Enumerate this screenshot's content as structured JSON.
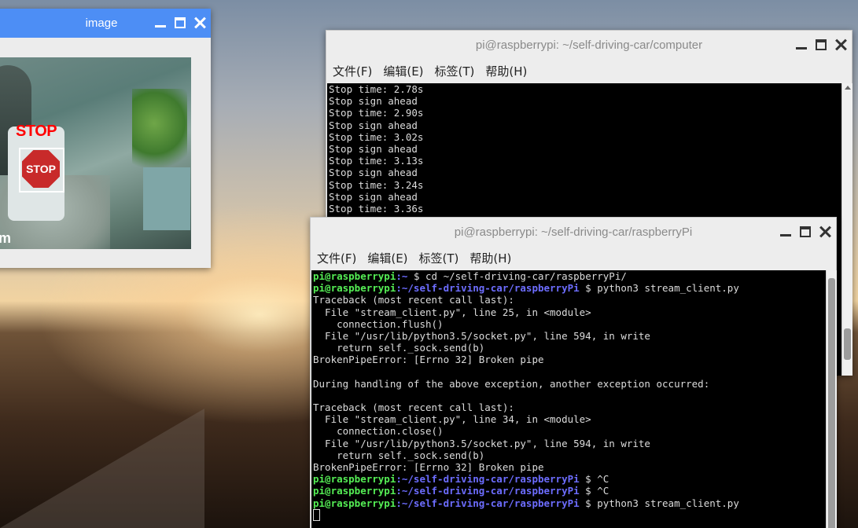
{
  "image_window": {
    "title": "image",
    "detection_label": "STOP",
    "sign_text": "STOP",
    "distance_text": "m"
  },
  "computer_window": {
    "title": "pi@raspberrypi: ~/self-driving-car/computer",
    "menu": [
      "文件(F)",
      "编辑(E)",
      "标签(T)",
      "帮助(H)"
    ],
    "lines": [
      "Stop time: 2.78s",
      "Stop sign ahead",
      "Stop time: 2.90s",
      "Stop sign ahead",
      "Stop time: 3.02s",
      "Stop sign ahead",
      "Stop time: 3.13s",
      "Stop sign ahead",
      "Stop time: 3.24s",
      "Stop sign ahead",
      "Stop time: 3.36s"
    ]
  },
  "raspberrypi_window": {
    "title": "pi@raspberrypi: ~/self-driving-car/raspberryPi",
    "menu": [
      "文件(F)",
      "编辑(E)",
      "标签(T)",
      "帮助(H)"
    ],
    "lines": [
      {
        "user": "pi@raspberrypi",
        "path": ":~",
        "cmd": " $ cd ~/self-driving-car/raspberryPi/"
      },
      {
        "user": "pi@raspberrypi",
        "path": ":~/self-driving-car/raspberryPi",
        "cmd": " $ python3 stream_client.py"
      },
      {
        "text": "Traceback (most recent call last):"
      },
      {
        "text": "  File \"stream_client.py\", line 25, in <module>"
      },
      {
        "text": "    connection.flush()"
      },
      {
        "text": "  File \"/usr/lib/python3.5/socket.py\", line 594, in write"
      },
      {
        "text": "    return self._sock.send(b)"
      },
      {
        "text": "BrokenPipeError: [Errno 32] Broken pipe"
      },
      {
        "text": ""
      },
      {
        "text": "During handling of the above exception, another exception occurred:"
      },
      {
        "text": ""
      },
      {
        "text": "Traceback (most recent call last):"
      },
      {
        "text": "  File \"stream_client.py\", line 34, in <module>"
      },
      {
        "text": "    connection.close()"
      },
      {
        "text": "  File \"/usr/lib/python3.5/socket.py\", line 594, in write"
      },
      {
        "text": "    return self._sock.send(b)"
      },
      {
        "text": "BrokenPipeError: [Errno 32] Broken pipe"
      },
      {
        "user": "pi@raspberrypi",
        "path": ":~/self-driving-car/raspberryPi",
        "cmd": " $ ^C"
      },
      {
        "user": "pi@raspberrypi",
        "path": ":~/self-driving-car/raspberryPi",
        "cmd": " $ ^C"
      },
      {
        "user": "pi@raspberrypi",
        "path": ":~/self-driving-car/raspberryPi",
        "cmd": " $ python3 stream_client.py"
      }
    ]
  },
  "colors": {
    "prompt_user": "#55ee55",
    "prompt_path": "#6d6dff",
    "image_titlebar": "#4d8ef5"
  }
}
